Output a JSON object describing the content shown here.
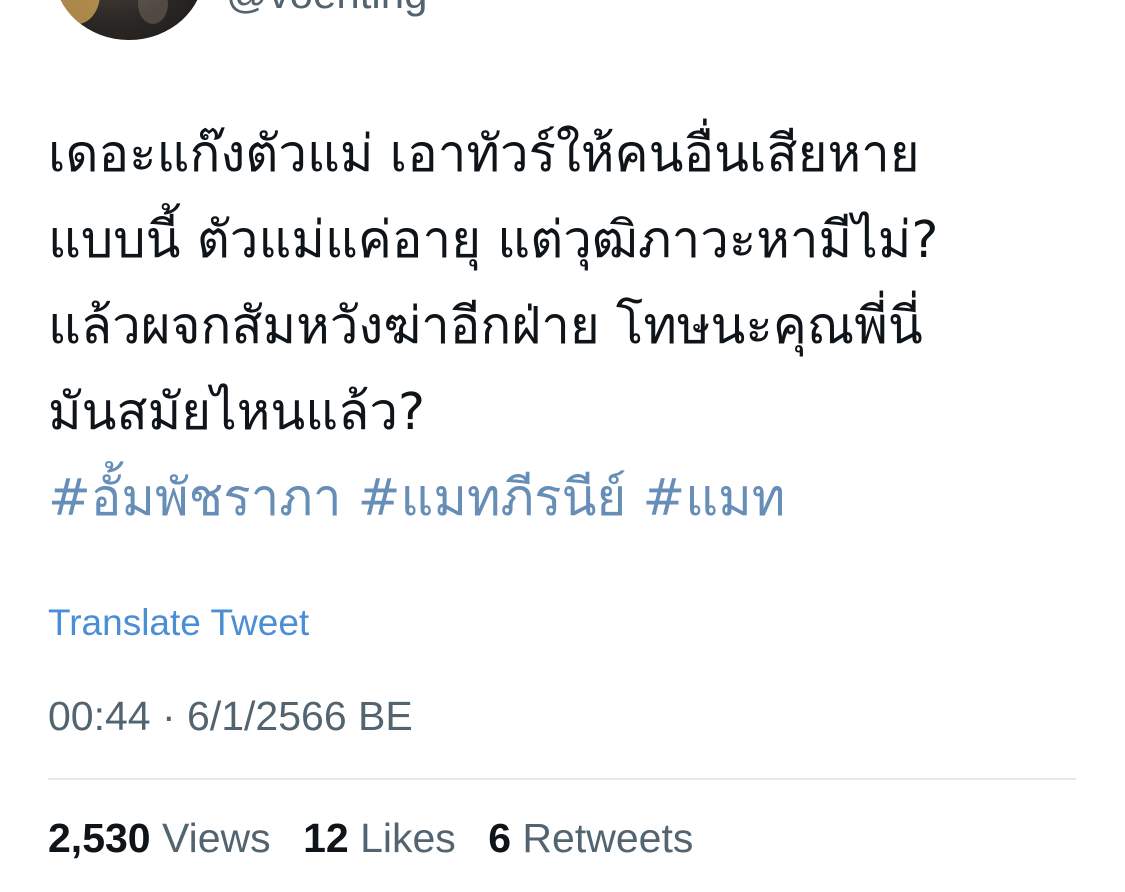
{
  "author": {
    "handle": "@voenting"
  },
  "tweet": {
    "lines": [
      "เดอะแก๊งตัวแม่ เอาทัวร์ให้คนอื่นเสียหาย",
      "แบบนี้ ตัวแม่แค่อายุ แต่วุฒิภาวะหามีไม่?",
      "แล้วผจกสัมหวังฆ่าอีกฝ่าย โทษนะคุณพี่นี่",
      "มันสมัยไหนแล้ว?"
    ],
    "hashtags": [
      "#อั้มพัชราภา",
      "#แมทภีรนีย์",
      "#แมท"
    ]
  },
  "translate_label": "Translate Tweet",
  "timestamp": "00:44 · 6/1/2566 BE",
  "stats": {
    "views": {
      "count": "2,530",
      "label": "Views"
    },
    "likes": {
      "count": "12",
      "label": "Likes"
    },
    "retweets": {
      "count": "6",
      "label": "Retweets"
    }
  },
  "colors": {
    "link": "#4a8fd6",
    "secondary_text": "#536471",
    "primary_text": "#0f1419"
  }
}
